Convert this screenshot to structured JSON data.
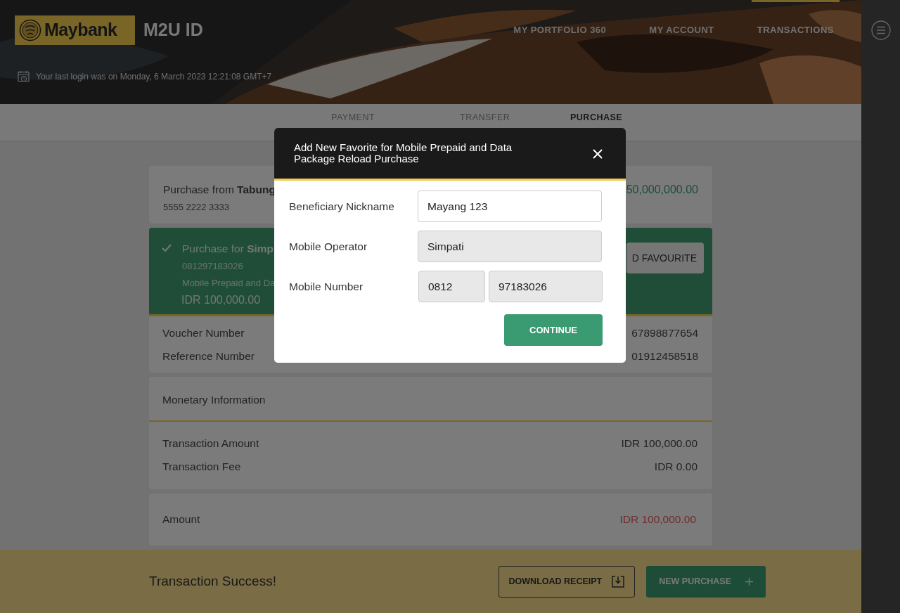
{
  "header": {
    "logo_text": "Maybank",
    "app_title": "M2U ID",
    "last_login": "Your last login was on Monday, 6 March 2023 12:21:08 GMT+7",
    "nav": [
      {
        "label": "MY PORTFOLIO 360",
        "selected": false
      },
      {
        "label": "MY ACCOUNT",
        "selected": false
      },
      {
        "label": "TRANSACTIONS",
        "selected": true
      }
    ]
  },
  "tabs": [
    {
      "label": "PAYMENT",
      "selected": false
    },
    {
      "label": "TRANSFER",
      "selected": false
    },
    {
      "label": "PURCHASE",
      "selected": true
    }
  ],
  "source": {
    "title": "Purchase from **Tabung**",
    "account": "5555 2222 3333",
    "balance": "50,000,000.00"
  },
  "purchase": {
    "title": "Purchase for **Simp**",
    "number": "081297183026",
    "product": "Mobile Prepaid and Da",
    "amount": "IDR 100,000.00",
    "favourite_button": "D FAVOURITE",
    "details": [
      {
        "label": "Voucher Number",
        "value": "67898877654"
      },
      {
        "label": "Reference Number",
        "value": "01912458518"
      }
    ]
  },
  "monetary": {
    "title": "Monetary Information",
    "rows": [
      {
        "label": "Transaction Amount",
        "value": "IDR 100,000.00"
      },
      {
        "label": "Transaction Fee",
        "value": "IDR 0.00"
      }
    ]
  },
  "total": {
    "label": "Amount",
    "value": "IDR 100,000.00"
  },
  "footer": {
    "message": "Transaction Success!",
    "buttons": [
      {
        "label": "DOWNLOAD RECEIPT",
        "kind": "outline"
      },
      {
        "label": "NEW PURCHASE",
        "kind": "primary"
      }
    ]
  },
  "dialog": {
    "title": "Add New Favorite for Mobile Prepaid and Data Package Reload Purchase",
    "button": "CONTINUE",
    "fields": [
      {
        "label": "Beneficiary Nickname",
        "values": [
          "Mayang 123"
        ],
        "disabled": false
      },
      {
        "label": "Mobile Operator",
        "values": [
          "Simpati"
        ],
        "disabled": true
      },
      {
        "label": "Mobile Number",
        "values": [
          "0812",
          "97183026"
        ],
        "disabled": true
      }
    ]
  }
}
